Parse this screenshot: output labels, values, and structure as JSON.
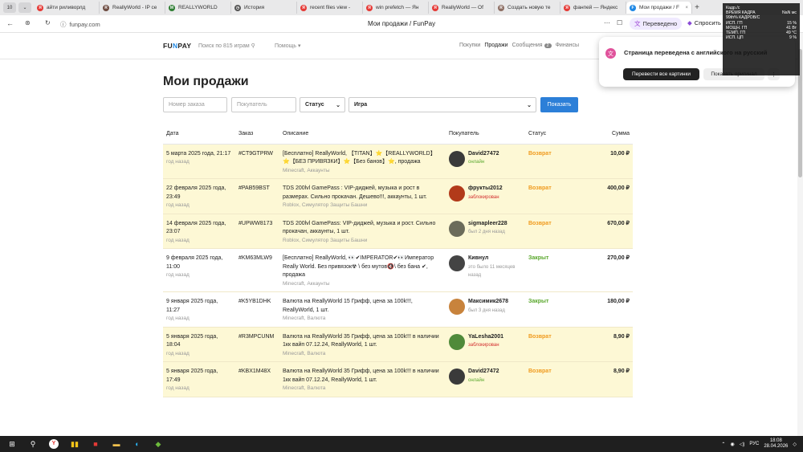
{
  "browser": {
    "tab_counter": "10",
    "tabs": [
      {
        "label": "айти риливорлд",
        "fav": "Я",
        "color": "#e53935"
      },
      {
        "label": "ReallyWorld - IP се",
        "fav": "R",
        "color": "#6d4c41"
      },
      {
        "label": "REALLYWORLD",
        "fav": "M",
        "color": "#2e7d32"
      },
      {
        "label": "История",
        "fav": "◷",
        "color": "#555555"
      },
      {
        "label": "recent files view -",
        "fav": "Я",
        "color": "#e53935"
      },
      {
        "label": "win prefetch — Ян",
        "fav": "Я",
        "color": "#e53935"
      },
      {
        "label": "ReallyWorld — Of",
        "fav": "Я",
        "color": "#e53935"
      },
      {
        "label": "Создать новую те",
        "fav": "R",
        "color": "#8d6e63"
      },
      {
        "label": "фанпей — Яндекс",
        "fav": "Я",
        "color": "#e53935"
      },
      {
        "label": "Мои продажи / F",
        "fav": "F",
        "color": "#1e88e5"
      }
    ],
    "url": "funpay.com",
    "page_title": "Мои продажи / FunPay",
    "translated_chip": "Переведено",
    "ask_label": "Спросить",
    "translate_popup": {
      "title": "Страница переведена с английского на русский",
      "btn_images": "Перевести все картинки",
      "btn_original": "Показать оригинал",
      "btn_more": "⋮"
    }
  },
  "overlay": [
    {
      "k": "Кадр./с",
      "v": ""
    },
    {
      "k": "ВРЕМЯ КАДРА",
      "v": "NaN мс"
    },
    {
      "k": "99th% КАДРОВ/С",
      "v": ""
    },
    {
      "k": "",
      "v": ""
    },
    {
      "k": "ИСП. ГП",
      "v": "15 %"
    },
    {
      "k": "МОЩН. ГП",
      "v": "41 Вт"
    },
    {
      "k": "ТЕМП. ГП",
      "v": "49 °C"
    },
    {
      "k": "ИСП. ЦП",
      "v": "9 %"
    }
  ],
  "site": {
    "logo_a": "FU",
    "logo_b": "N",
    "logo_c": "PAY",
    "search": "Поиск по 815 играм",
    "help": "Помощь",
    "menu": {
      "purchases": "Покупки",
      "sales": "Продажи",
      "messages": "Сообщения",
      "messages_count": "2",
      "finance": "Финансы"
    }
  },
  "main": {
    "title": "Мои продажи",
    "filters": {
      "order_placeholder": "Номер заказа",
      "buyer_placeholder": "Покупатель",
      "status": "Статус",
      "game": "Игра",
      "show": "Показать"
    },
    "columns": [
      "Дата",
      "Заказ",
      "Описание",
      "Покупатель",
      "Статус",
      "Сумма"
    ],
    "rows": [
      {
        "date": "5 марта 2025 года, 21:17",
        "ago": "год назад",
        "order": "#CT9GTPRW",
        "desc": "[Бесплатно] ReallyWorld, 【TITAN】⭐【REALLYWORLD】⭐【БЕЗ ПРИВЯЗКИ】⭐【Без банов】⭐, продажа",
        "cat": "Minecraft, Аккаунты",
        "buyer": "David27472",
        "bstatus": "онлайн",
        "bcolor": "#5ba82e",
        "av": "#3a3a3a",
        "status": "Возврат",
        "st": "ret",
        "sum": "10,00 ₽",
        "hl": true
      },
      {
        "date": "22 февраля 2025 года, 23:49",
        "ago": "год назад",
        "order": "#PAB59BST",
        "desc": "TDS 200lvl GamePass : VIP-диджей, музыка и рост в размерах. Сильно прокачан. Дешево!!!, аккаунты, 1 шт.",
        "cat": "Roblox, Симулятор Защиты Башни",
        "buyer": "фрукты2012",
        "bstatus": "заблокирован",
        "bcolor": "#d32f2f",
        "av": "#b23a1a",
        "status": "Возврат",
        "st": "ret",
        "sum": "400,00 ₽",
        "hl": true
      },
      {
        "date": "14 февраля 2025 года, 23:07",
        "ago": "год назад",
        "order": "#UPWW8173",
        "desc": "TDS 200lvl GamePass: VIP-диджей, музыка и рост. Сильно прокачан, аккаунты, 1 шт.",
        "cat": "Roblox, Симулятор Защиты Башни",
        "buyer": "sigmapleer228",
        "bstatus": "был 2 дня назад",
        "bcolor": "#999999",
        "av": "#6b6b5a",
        "status": "Возврат",
        "st": "ret",
        "sum": "670,00 ₽",
        "hl": true
      },
      {
        "date": "9 февраля 2025 года, 11:00",
        "ago": "год назад",
        "order": "#KM63MLW9",
        "desc": "[Бесплатно] ReallyWorld, 👀✔IMPERATOR✔👀Император Really World. Без привязок☢ \\ без мутов🔇\\ без бана ✔, продажа",
        "cat": "Minecraft, Аккаунты",
        "buyer": "Кивнул",
        "bstatus": "это было 11 месяцев назад",
        "bcolor": "#999999",
        "av": "#444444",
        "status": "Закрыт",
        "st": "cl",
        "sum": "270,00 ₽",
        "hl": false
      },
      {
        "date": "9 января 2025 года, 11:27",
        "ago": "год назад",
        "order": "#K5YB1DHK",
        "desc": "Валюта на ReallyWorld 15 Грифф, цена за 100k!!!, ReallyWorld, 1 шт.",
        "cat": "Minecraft, Валюта",
        "buyer": "Максимик2678",
        "bstatus": "был 3 дня назад",
        "bcolor": "#999999",
        "av": "#c8833c",
        "status": "Закрыт",
        "st": "cl",
        "sum": "180,00 ₽",
        "hl": false
      },
      {
        "date": "5 января 2025 года, 18:04",
        "ago": "год назад",
        "order": "#R3MPCUNM",
        "desc": "Валюта на ReallyWorld 35 Грифф, цена за 100k!!! в наличии 1кк вайп 07.12.24, ReallyWorld, 1 шт.",
        "cat": "Minecraft, Валюта",
        "buyer": "YaLesha2001",
        "bstatus": "заблокирован",
        "bcolor": "#d32f2f",
        "av": "#4f8a3a",
        "status": "Возврат",
        "st": "ret",
        "sum": "8,90 ₽",
        "hl": true
      },
      {
        "date": "5 января 2025 года, 17:49",
        "ago": "год назад",
        "order": "#KBX1M48X",
        "desc": "Валюта на ReallyWorld 35 Грифф, цена за 100k!!! в наличии 1кк вайп 07.12.24, ReallyWorld, 1 шт.",
        "cat": "Minecraft, Валюта",
        "buyer": "David27472",
        "bstatus": "онлайн",
        "bcolor": "#5ba82e",
        "av": "#3a3a3a",
        "status": "Возврат",
        "st": "ret",
        "sum": "8,90 ₽",
        "hl": true
      }
    ]
  },
  "taskbar": {
    "lang": "РУС",
    "time": "18:08",
    "date": "28.04.2026"
  }
}
